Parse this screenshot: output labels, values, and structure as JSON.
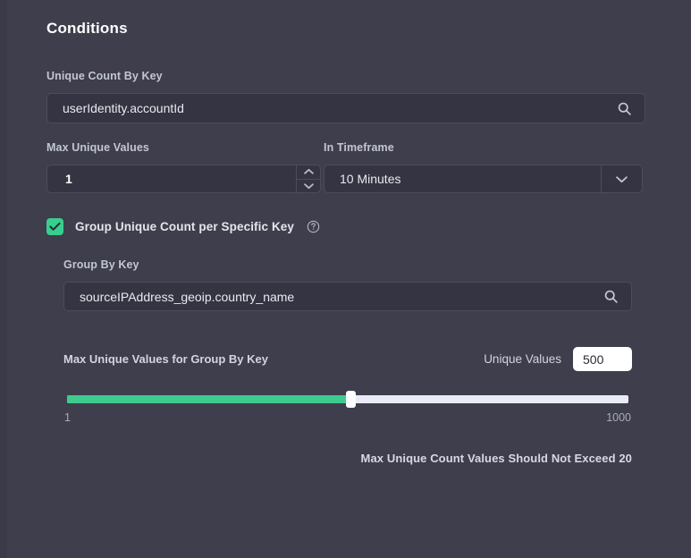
{
  "panel": {
    "title": "Conditions",
    "bg_color": "#3e3e4d"
  },
  "unique_count_by_key": {
    "label": "Unique Count By Key",
    "value": "userIdentity.accountId",
    "placeholder": "",
    "icon": "search-icon"
  },
  "max_unique_values": {
    "label": "Max Unique Values",
    "value": "1"
  },
  "in_timeframe": {
    "label": "In Timeframe",
    "value": "10 Minutes",
    "options": [
      "10 Minutes"
    ]
  },
  "group_toggle": {
    "label": "Group Unique Count per Specific Key",
    "checked": true,
    "check_color": "#38cf8e",
    "help_icon": "help-circle-icon"
  },
  "group_by_key": {
    "label": "Group By Key",
    "value": "sourceIPAddress_geoip.country_name",
    "icon": "search-icon"
  },
  "slider": {
    "title": "Max Unique Values for Group By Key",
    "unique_values_label": "Unique Values",
    "unique_values": "500",
    "min_label": "1",
    "max_label": "1000",
    "fill_color": "#3fcb8e",
    "track_color": "#e8ecf4"
  },
  "warning": {
    "text": "Max Unique Count Values Should Not Exceed 20"
  }
}
